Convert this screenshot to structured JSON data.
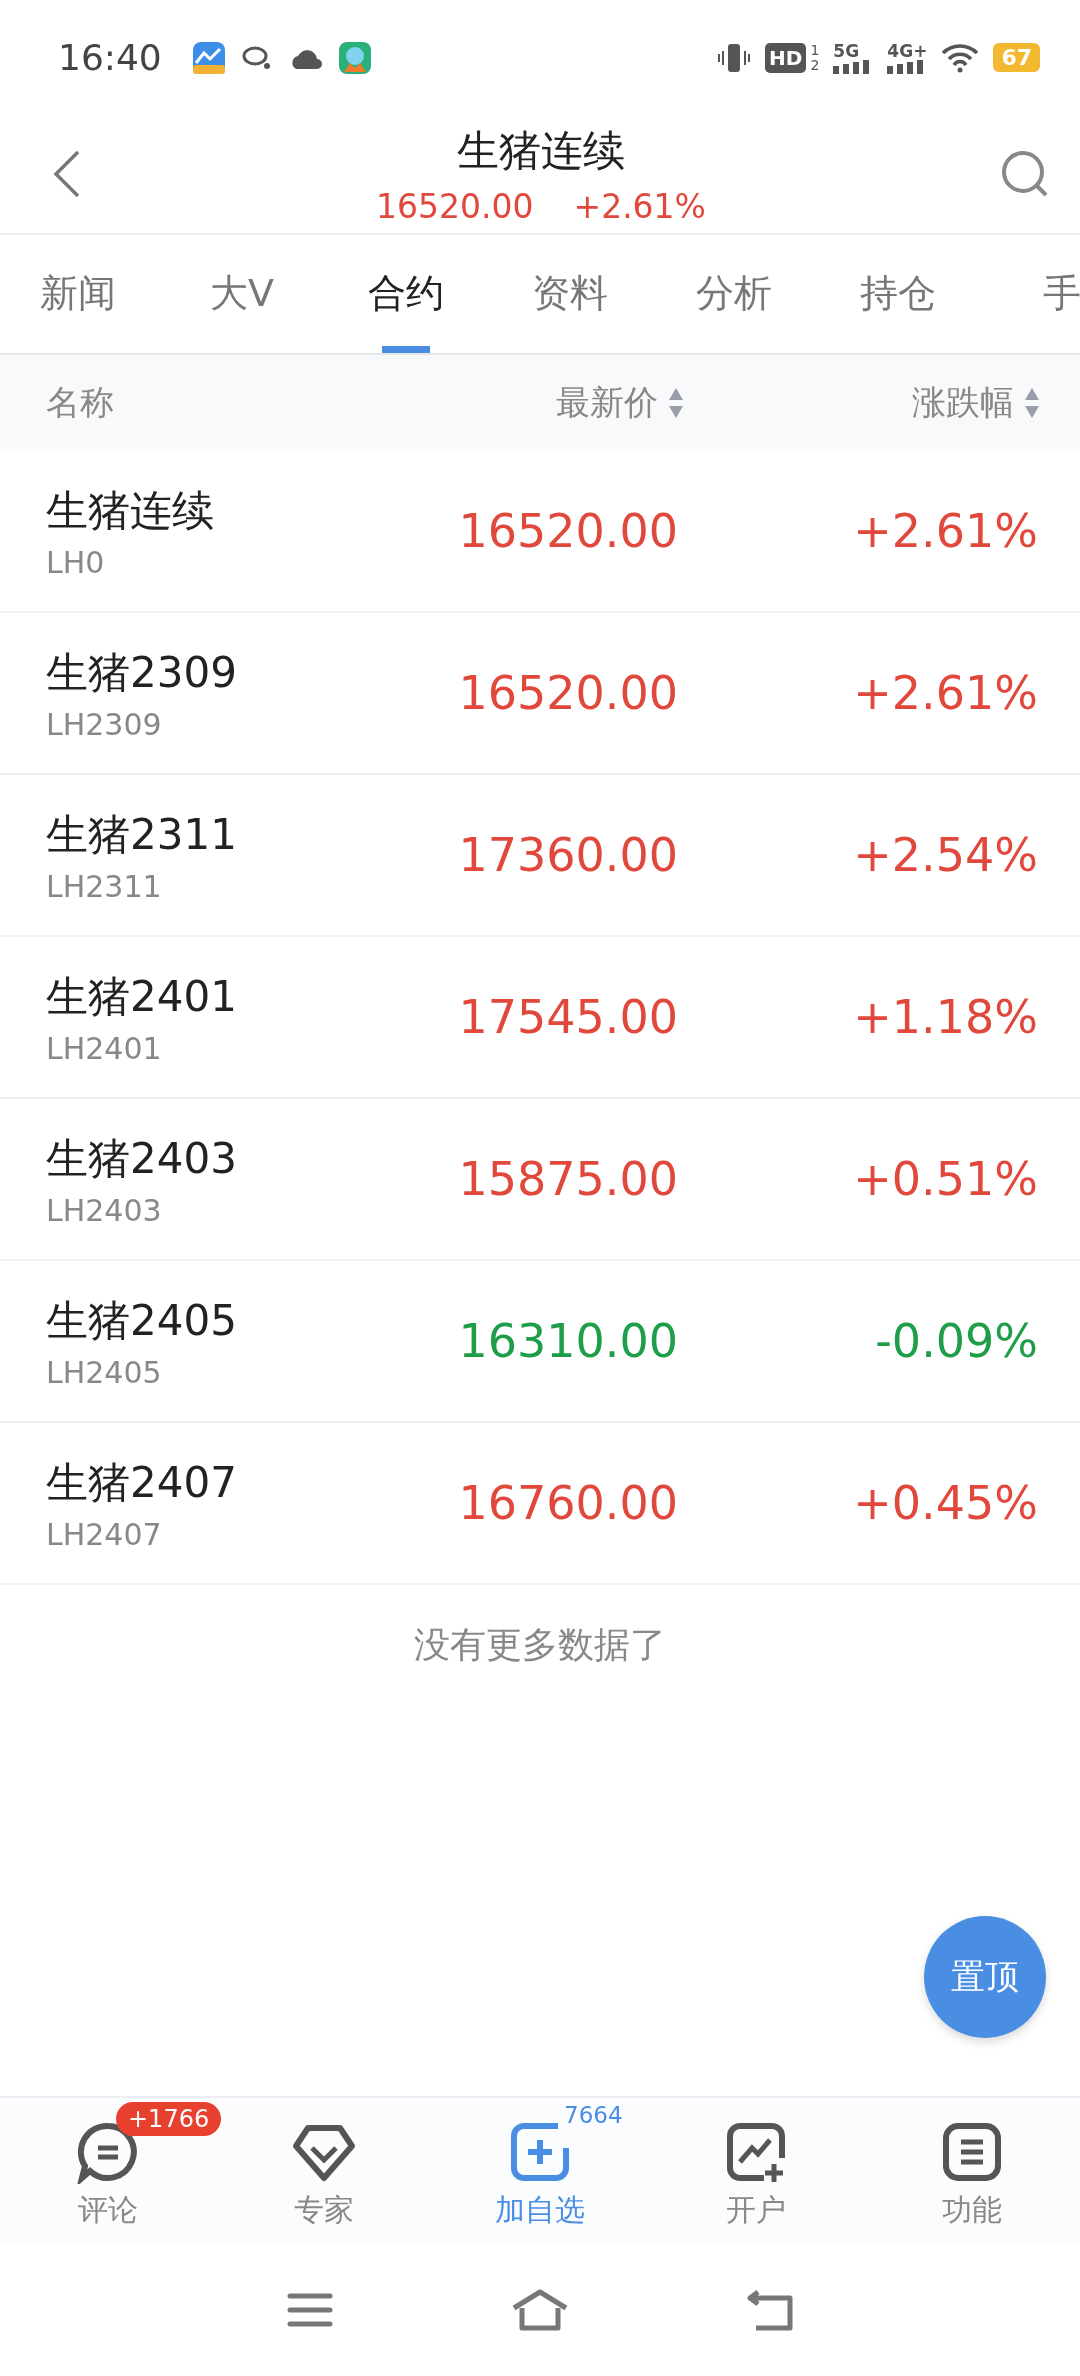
{
  "status_bar": {
    "time": "16:40",
    "hd": "HD",
    "hd_sup": "1",
    "hd_sub": "2",
    "net1": "5G",
    "net2": "4G+",
    "battery": "67"
  },
  "header": {
    "title": "生猪连续",
    "price": "16520.00",
    "change": "+2.61%"
  },
  "tabs": [
    {
      "label": "新闻",
      "selected": false
    },
    {
      "label": "大V",
      "selected": false
    },
    {
      "label": "合约",
      "selected": true
    },
    {
      "label": "资料",
      "selected": false
    },
    {
      "label": "分析",
      "selected": false
    },
    {
      "label": "持仓",
      "selected": false
    },
    {
      "label": "手",
      "selected": false
    }
  ],
  "table": {
    "columns": [
      "名称",
      "最新价",
      "涨跌幅"
    ],
    "rows": [
      {
        "name": "生猪连续",
        "code": "LH0",
        "price": "16520.00",
        "change": "+2.61%",
        "color": "#e0483c"
      },
      {
        "name": "生猪2309",
        "code": "LH2309",
        "price": "16520.00",
        "change": "+2.61%",
        "color": "#e0483c"
      },
      {
        "name": "生猪2311",
        "code": "LH2311",
        "price": "17360.00",
        "change": "+2.54%",
        "color": "#e0483c"
      },
      {
        "name": "生猪2401",
        "code": "LH2401",
        "price": "17545.00",
        "change": "+1.18%",
        "color": "#e0483c"
      },
      {
        "name": "生猪2403",
        "code": "LH2403",
        "price": "15875.00",
        "change": "+0.51%",
        "color": "#e0483c"
      },
      {
        "name": "生猪2405",
        "code": "LH2405",
        "price": "16310.00",
        "change": "-0.09%",
        "color": "#1e9e48"
      },
      {
        "name": "生猪2407",
        "code": "LH2407",
        "price": "16760.00",
        "change": "+0.45%",
        "color": "#e0483c"
      }
    ]
  },
  "end_note": "没有更多数据了",
  "top_button": "置顶",
  "bottom_nav": [
    {
      "kind": "comment",
      "label": "评论",
      "badge": "+1766",
      "selected": false
    },
    {
      "kind": "expert",
      "label": "专家",
      "selected": false
    },
    {
      "kind": "add",
      "label": "加自选",
      "count": "7664",
      "selected": true
    },
    {
      "kind": "account",
      "label": "开户",
      "selected": false
    },
    {
      "kind": "menu",
      "label": "功能",
      "selected": false
    }
  ]
}
